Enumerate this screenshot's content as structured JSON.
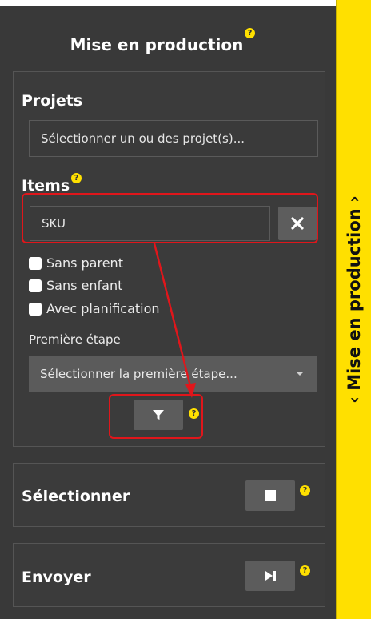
{
  "panel_title": "Mise en production",
  "sidebar_label": "‹ Mise en production ›",
  "projets": {
    "label": "Projets",
    "placeholder": "Sélectionner un ou des projet(s)..."
  },
  "items": {
    "label": "Items",
    "value": "SKU",
    "checkboxes": [
      "Sans parent",
      "Sans enfant",
      "Avec planification"
    ],
    "first_step_label": "Première étape",
    "first_step_placeholder": "Sélectionner la première étape..."
  },
  "select_section": {
    "label": "Sélectionner"
  },
  "send_section": {
    "label": "Envoyer"
  },
  "help_glyph": "?",
  "colors": {
    "accent": "#ffe000",
    "panel": "#393939",
    "annotation": "#e0161b"
  }
}
